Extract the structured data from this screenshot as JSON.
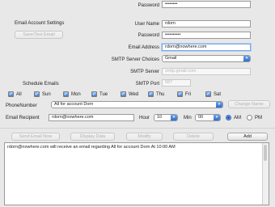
{
  "credentials_top": {
    "password_label": "Password",
    "password_value": "••••••••"
  },
  "email_settings": {
    "section_label": "Email Account Settings",
    "save_test_label": "Save/Test Email",
    "user_name_label": "User Name",
    "user_name_value": "rdorn",
    "password_label": "Password",
    "password_value": "••••••••••",
    "email_address_label": "Email Address",
    "email_address_value": "rdorn@nowhere.com",
    "smtp_choices_label": "SMTP Server Choices",
    "smtp_choice_value": "Gmail",
    "smtp_server_label": "SMTP Server",
    "smtp_server_value": "smtp.gmail.com",
    "smtp_port_label": "SMTP Port",
    "smtp_port_value": "587"
  },
  "schedule": {
    "label": "Schedule Emails",
    "days": [
      {
        "label": "All",
        "checked": true
      },
      {
        "label": "Sun",
        "checked": true
      },
      {
        "label": "Mon",
        "checked": true
      },
      {
        "label": "Tue",
        "checked": true
      },
      {
        "label": "Wed",
        "checked": true
      },
      {
        "label": "Thu",
        "checked": true
      },
      {
        "label": "Fri",
        "checked": true
      },
      {
        "label": "Sat",
        "checked": true
      }
    ]
  },
  "phone": {
    "label": "PhoneNumber",
    "selected": "All for account Dorn",
    "change_label": "Change Name"
  },
  "recipient": {
    "label": "Email Recipient",
    "value": "rdorn@nowhere.com",
    "hour_label": "Hour",
    "hour_value": "10",
    "min_label": "Min",
    "min_value": "00",
    "am_label": "AM",
    "pm_label": "PM"
  },
  "actions": {
    "send_now": "Send Email Now",
    "display_data": "Display Data",
    "modify": "Modify",
    "delete": "Delete",
    "add": "Add"
  },
  "log": {
    "line1": "rdorn@nowhere.com will receive an email regarding All for account Dorn At 10:00 AM"
  }
}
